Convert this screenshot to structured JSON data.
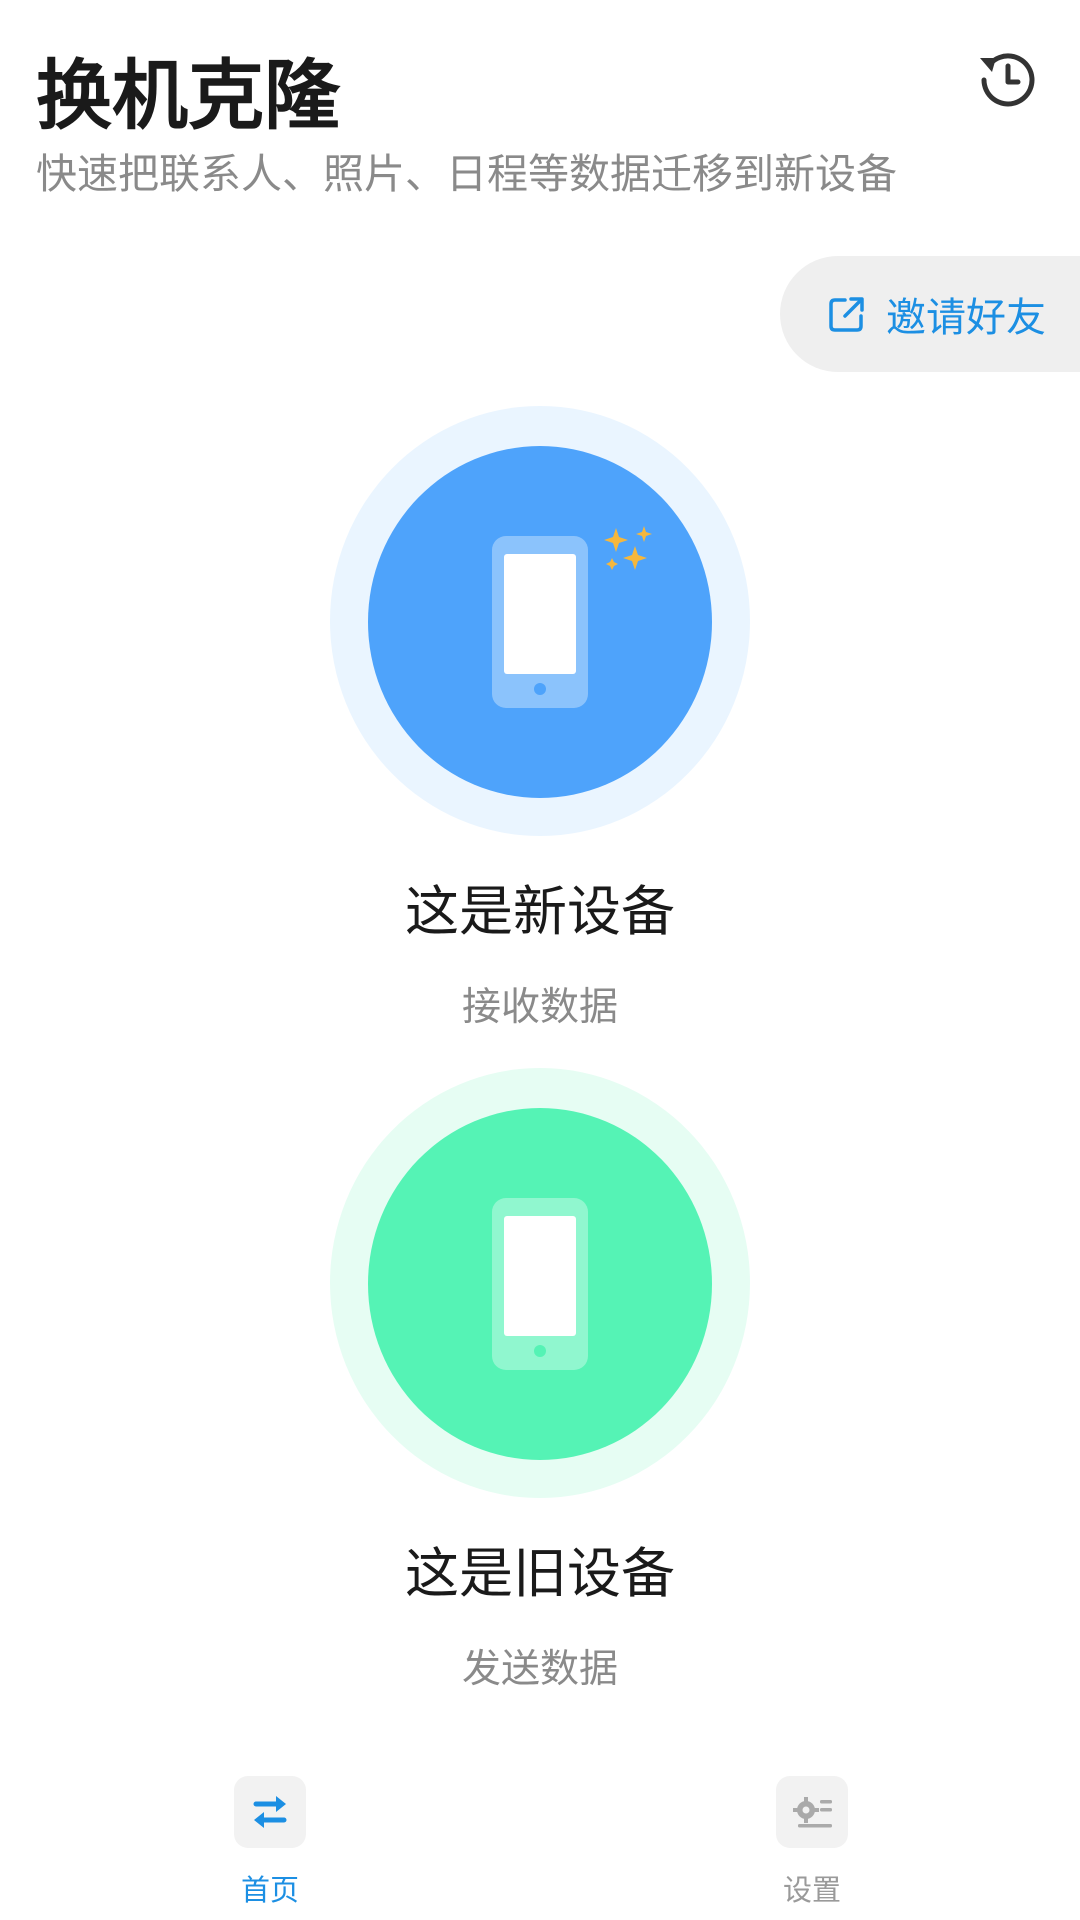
{
  "header": {
    "title": "换机克隆",
    "subtitle": "快速把联系人、照片、日程等数据迁移到新设备",
    "history_icon": "history-icon"
  },
  "invite": {
    "label": "邀请好友",
    "icon": "share-external-icon",
    "text_color": "#1c8fe3"
  },
  "options": {
    "new_device": {
      "label": "这是新设备",
      "sub": "接收数据",
      "icon": "phone-sparkle-icon",
      "color": "#4ea3fb",
      "halo_color": "#eaf5ff"
    },
    "old_device": {
      "label": "这是旧设备",
      "sub": "发送数据",
      "icon": "phone-icon",
      "color": "#55f3b5",
      "halo_color": "#e6fdf3"
    }
  },
  "tabbar": {
    "home": {
      "label": "首页",
      "icon": "swap-arrows-icon",
      "color": "#1c8fe3"
    },
    "settings": {
      "label": "设置",
      "icon": "gear-list-icon",
      "color": "#9a9a9a"
    }
  }
}
